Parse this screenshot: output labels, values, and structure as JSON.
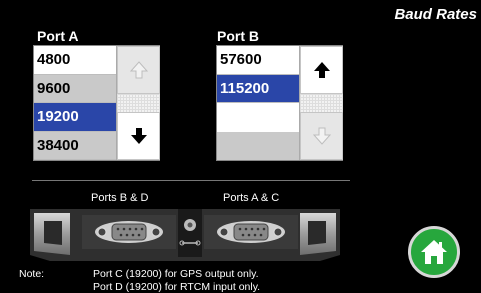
{
  "title": "Baud Rates",
  "port_a": {
    "label": "Port A",
    "items": [
      "4800",
      "9600",
      "19200",
      "38400"
    ],
    "selected": "19200"
  },
  "port_b": {
    "label": "Port B",
    "items": [
      "57600",
      "115200"
    ],
    "selected": "115200"
  },
  "connectors": {
    "left_label": "Ports B & D",
    "right_label": "Ports A & C"
  },
  "note": {
    "label": "Note:",
    "line1": "Port C (19200) for GPS output only.",
    "line2": "Port D (19200) for RTCM input only."
  },
  "icons": {
    "up": "arrow-up-icon",
    "down": "arrow-down-icon",
    "home": "home-icon"
  },
  "colors": {
    "selected_bg": "#2a46a8",
    "home_green": "#27a73d"
  }
}
